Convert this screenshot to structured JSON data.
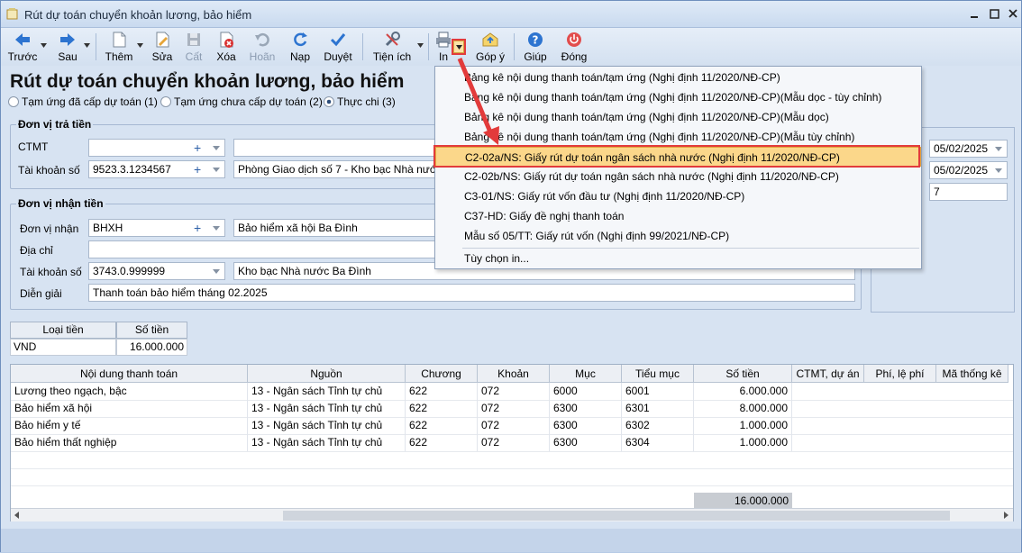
{
  "window": {
    "title": "Rút dự toán chuyển khoản lương, bảo hiểm"
  },
  "toolbar": {
    "back": "Trước",
    "forward": "Sau",
    "add": "Thêm",
    "edit": "Sửa",
    "save": "Cất",
    "delete": "Xóa",
    "undo": "Hoãn",
    "reload": "Nạp",
    "approve": "Duyệt",
    "tools": "Tiện ích",
    "print": "In",
    "feedback": "Góp ý",
    "help": "Giúp",
    "close": "Đóng"
  },
  "form": {
    "heading": "Rút dự toán chuyển khoản lương, bảo hiểm",
    "radios": [
      {
        "label": "Tạm ứng đã cấp dự toán (1)",
        "checked": false
      },
      {
        "label": "Tạm ứng chưa cấp dự toán (2)",
        "checked": false
      },
      {
        "label": "Thực chi (3)",
        "checked": true
      }
    ],
    "payer": {
      "group_title": "Đơn vị trả tiền",
      "ctmt_label": "CTMT",
      "ctmt_value": "",
      "ctmt_name": "",
      "account_label": "Tài khoản số",
      "account_value": "9523.3.1234567",
      "account_name": "Phòng Giao dịch số 7 - Kho bạc Nhà nước K"
    },
    "payee": {
      "group_title": "Đơn vị nhận tiền",
      "unit_label": "Đơn vị nhận",
      "unit_value": "BHXH",
      "unit_name": "Bảo hiểm xã hội Ba Đình",
      "address_label": "Địa chỉ",
      "address_value": "",
      "account_label": "Tài khoản số",
      "account_value": "3743.0.999999",
      "account_name": "Kho bạc Nhà nước Ba Đình",
      "desc_label": "Diễn giải",
      "desc_value": "Thanh toán bảo hiểm tháng 02.2025"
    },
    "right": {
      "date1": "05/02/2025",
      "date2": "05/02/2025",
      "number": "7"
    }
  },
  "currency_grid": {
    "headers": [
      "Loại tiền",
      "Số tiền"
    ],
    "row": [
      "VND",
      "16.000.000"
    ]
  },
  "detail_grid": {
    "headers": [
      "Nội dung thanh toán",
      "Nguồn",
      "Chương",
      "Khoản",
      "Mục",
      "Tiểu mục",
      "Số tiền",
      "CTMT, dự án",
      "Phí, lệ phí",
      "Mã thống kê"
    ],
    "rows": [
      [
        "Lương theo ngạch, bậc",
        "13 - Ngân sách Tỉnh tự chủ",
        "622",
        "072",
        "6000",
        "6001",
        "6.000.000"
      ],
      [
        "Bảo hiểm xã hội",
        "13 - Ngân sách Tỉnh tự chủ",
        "622",
        "072",
        "6300",
        "6301",
        "8.000.000"
      ],
      [
        "Bảo hiểm y tế",
        "13 - Ngân sách Tỉnh tự chủ",
        "622",
        "072",
        "6300",
        "6302",
        "1.000.000"
      ],
      [
        "Bảo hiểm thất nghiệp",
        "13 - Ngân sách Tỉnh tự chủ",
        "622",
        "072",
        "6300",
        "6304",
        "1.000.000"
      ]
    ],
    "total": "16.000.000"
  },
  "print_menu": {
    "items": [
      "Bảng kê nội dung thanh toán/tạm ứng (Nghị định 11/2020/NĐ-CP)",
      "Bảng kê nội dung thanh toán/tạm ứng (Nghị định 11/2020/NĐ-CP)(Mẫu dọc - tùy chỉnh)",
      "Bảng kê nội dung thanh toán/tạm ứng (Nghị định 11/2020/NĐ-CP)(Mẫu dọc)",
      "Bảng kê nội dung thanh toán/tạm ứng (Nghị định 11/2020/NĐ-CP)(Mẫu tùy chỉnh)",
      "C2-02a/NS: Giấy rút dự toán ngân sách nhà nước (Nghị định 11/2020/NĐ-CP)",
      "C2-02b/NS: Giấy rút dự toán ngân sách nhà nước (Nghị định 11/2020/NĐ-CP)",
      "C3-01/NS: Giấy rút vốn đầu tư (Nghị định 11/2020/NĐ-CP)",
      "C37-HD: Giấy đề nghị thanh toán",
      "Mẫu số 05/TT: Giấy rút vốn (Nghị định 99/2021/NĐ-CP)"
    ],
    "custom": "Tùy chọn in...",
    "highlighted_index": 4
  },
  "colors": {
    "accent": "#e23b3b",
    "highlight": "#fbd78a"
  }
}
